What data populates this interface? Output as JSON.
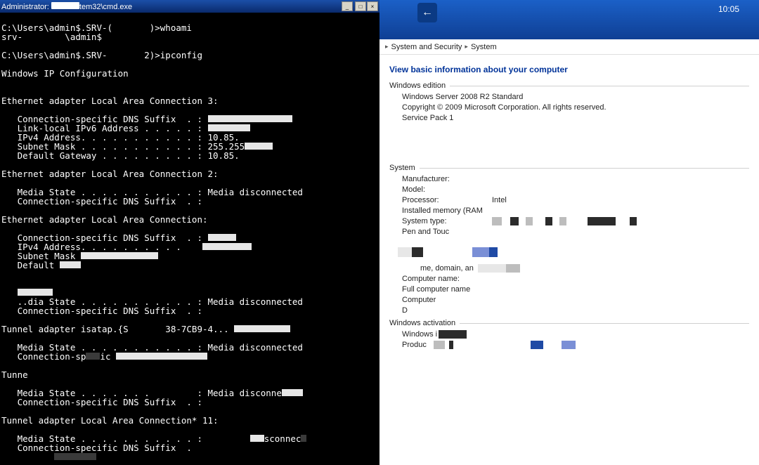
{
  "cmd": {
    "title_prefix": "Administrator: ",
    "title_suffix": "tem32\\cmd.exe",
    "prompt1": "C:\\Users\\admin$.SRV-(       )>whoami",
    "out1": "srv-        \\admin$",
    "prompt2": "C:\\Users\\admin$.SRV-       2)>ipconfig",
    "hdr": "Windows IP Configuration",
    "ad3": "Ethernet adapter Local Area Connection 3:",
    "l_csuff": "   Connection-specific DNS Suffix  . :",
    "l_ll6": "   Link-local IPv6 Address . . . . . :",
    "l_ip4": "   IPv4 Address. . . . . . . . . . . : 10.85.",
    "l_mask": "   Subnet Mask . . . . . . . . . . . : 255.255",
    "l_gw": "   Default Gateway . . . . . . . . . : 10.85.",
    "ad2": "Ethernet adapter Local Area Connection 2:",
    "l_media": "   Media State . . . . . . . . . . . : Media disconnected",
    "l_media2": "   Media State . . . . . . .         : Media disconne",
    "l_media3": "   Media State . . . . . . . . . . . :         .sconnec",
    "ad": "Ethernet adapter Local Area Connection:",
    "l_ip4b": "   IPv4 Address. . . . . . . . . .",
    "l_maskb": "   Subnet Mask",
    "l_defb": "   Default",
    "l_state": "   ..dia State . . . . . . . . . . . : Media disconnected",
    "tun_is": "Tunnel adapter isatap.{S       38-7CB9-4...",
    "tunn": "Tunne",
    "tun11": "Tunnel adapter Local Area Connection* 11:",
    "l_media4": "   Media State . . . . . . . . . . . :",
    "l_csuff2": "   Connection-specific DNS Suffix  ."
  },
  "right": {
    "time": "10:05",
    "bc1": "System and Security",
    "bc2": "System",
    "heading": "View basic information about your computer",
    "grp_edition": "Windows edition",
    "os_name": "Windows Server 2008 R2 Standard",
    "copyright": "Copyright © 2009 Microsoft Corporation.  All rights reserved.",
    "sp": "Service Pack 1",
    "grp_system": "System",
    "manu": "Manufacturer:",
    "model": "Model:",
    "proc": "Processor:",
    "proc_val": "Intel",
    "ram": "Installed memory (RAM",
    "systype": "System type:",
    "pen": "Pen and Touc",
    "name_domain": "me, domain, an",
    "compname": "Computer name:",
    "fullname": "Full computer name",
    "computer": "Computer",
    "d": "D",
    "grp_act": "Windows activation",
    "winact": "Windows i",
    "prod": "Produc"
  }
}
